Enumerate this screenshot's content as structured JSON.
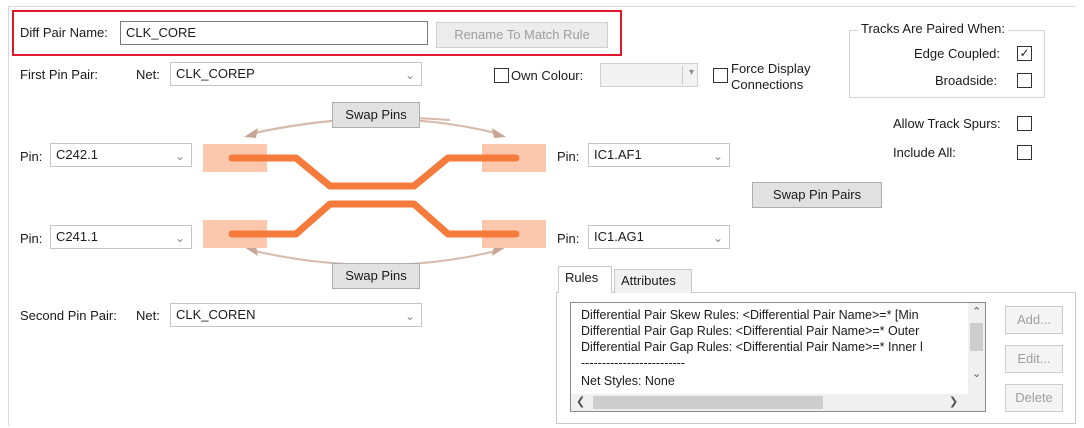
{
  "diff_pair": {
    "name_label": "Diff Pair Name:",
    "name_value": "CLK_CORE",
    "rename_button": "Rename To Match Rule"
  },
  "first_pair": {
    "label": "First Pin Pair:",
    "net_label": "Net:",
    "net_value": "CLK_COREP"
  },
  "second_pair": {
    "label": "Second Pin Pair:",
    "net_label": "Net:",
    "net_value": "CLK_COREN"
  },
  "pins": {
    "pin_label": "Pin:",
    "left_top": "C242.1",
    "left_bottom": "C241.1",
    "right_top": "IC1.AF1",
    "right_bottom": "IC1.AG1"
  },
  "buttons": {
    "swap_pins_top": "Swap Pins",
    "swap_pins_bottom": "Swap Pins",
    "swap_pin_pairs": "Swap Pin Pairs",
    "add": "Add...",
    "edit": "Edit...",
    "delete": "Delete"
  },
  "own_colour": {
    "label": "Own Colour:",
    "checked": false
  },
  "force_display": {
    "line1": "Force Display",
    "line2": "Connections",
    "checked": false
  },
  "tracks_group": {
    "title": "Tracks Are Paired When:",
    "edge_coupled_label": "Edge Coupled:",
    "edge_coupled_checked": true,
    "broadside_label": "Broadside:",
    "broadside_checked": false
  },
  "allow_track_spurs": {
    "label": "Allow Track Spurs:",
    "checked": false
  },
  "include_all": {
    "label": "Include All:",
    "checked": false
  },
  "tabs": [
    "Rules",
    "Attributes"
  ],
  "rules_list": [
    "Differential Pair Skew Rules: <Differential Pair Name>=*  [Min",
    "Differential Pair Gap Rules: <Differential Pair Name>=* Outer",
    "Differential Pair Gap Rules: <Differential Pair Name>=* Inner l",
    "-------------------------",
    "Net Styles: None"
  ],
  "icons": {
    "dropdown": "chevron-down-icon",
    "scroll_up": "scroll-up-arrow-icon",
    "scroll_down": "scroll-down-arrow-icon",
    "scroll_left": "scroll-left-arrow-icon",
    "scroll_right": "scroll-right-arrow-icon",
    "check": "checkmark-icon"
  },
  "colors": {
    "highlight_box": "#e0182c",
    "track": "#f47b3c",
    "pad": "#fbc8ad",
    "swap_arc": "#d7b9a9"
  }
}
